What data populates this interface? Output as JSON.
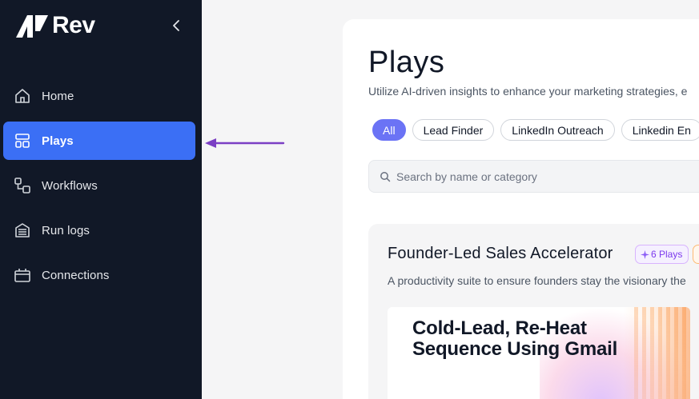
{
  "brand": {
    "name": "Rev"
  },
  "sidebar": {
    "items": [
      {
        "label": "Home",
        "icon": "home-icon"
      },
      {
        "label": "Plays",
        "icon": "layout-icon",
        "active": true
      },
      {
        "label": "Workflows",
        "icon": "workflow-icon"
      },
      {
        "label": "Run logs",
        "icon": "database-icon"
      },
      {
        "label": "Connections",
        "icon": "connections-icon"
      }
    ]
  },
  "main": {
    "title": "Plays",
    "subtitle": "Utilize AI-driven insights to enhance your marketing strategies, e",
    "filters": [
      "All",
      "Lead Finder",
      "LinkedIn Outreach",
      "Linkedin En"
    ],
    "search": {
      "placeholder": "Search by name or category"
    },
    "group": {
      "title": "Founder-Led Sales Accelerator",
      "badge": "6 Plays",
      "description": "A productivity suite to ensure founders stay the visionary the",
      "thumbnail_title": "Cold-Lead, Re-Heat Sequence Using Gmail"
    }
  },
  "colors": {
    "sidebar_bg": "#111827",
    "active_nav": "#3b6ff5",
    "active_chip": "#6b73f5",
    "arrow": "#7b3fc4",
    "badge_purple": "#7c3aed"
  }
}
